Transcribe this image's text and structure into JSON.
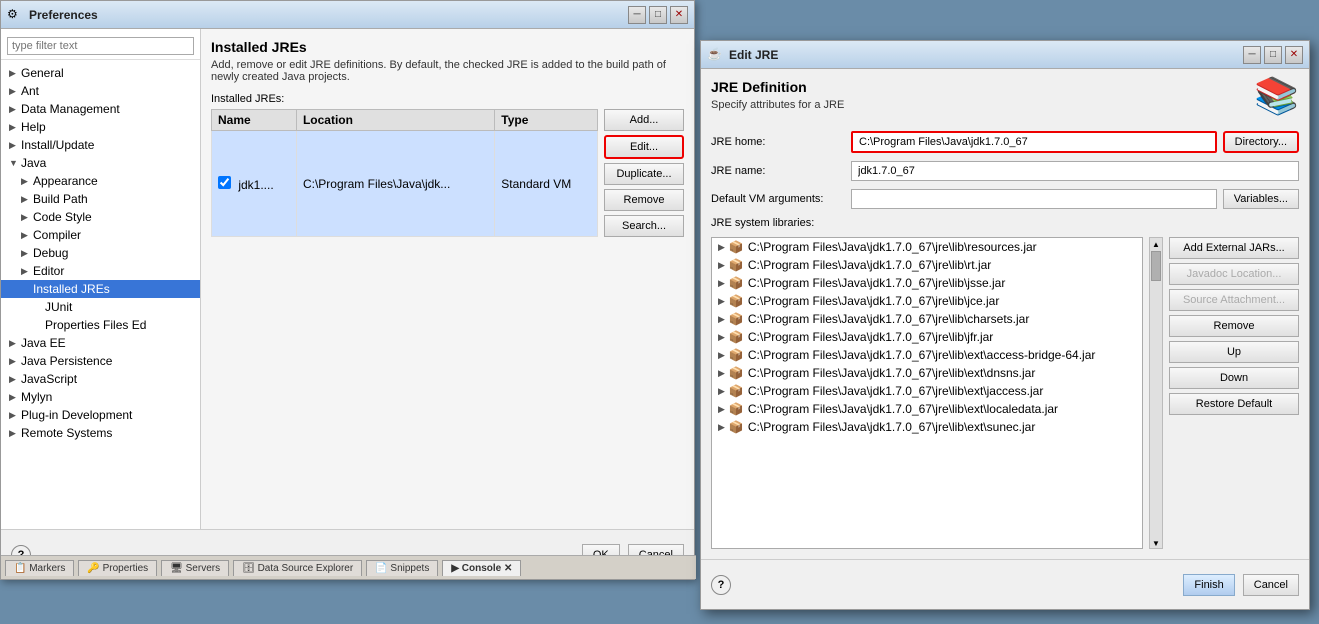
{
  "preferences": {
    "title": "Preferences",
    "filter_placeholder": "type filter text",
    "sidebar": {
      "items": [
        {
          "id": "general",
          "label": "General",
          "level": 1,
          "arrow": "▶",
          "selected": false
        },
        {
          "id": "ant",
          "label": "Ant",
          "level": 1,
          "arrow": "▶",
          "selected": false
        },
        {
          "id": "data-management",
          "label": "Data Management",
          "level": 1,
          "arrow": "▶",
          "selected": false
        },
        {
          "id": "help",
          "label": "Help",
          "level": 1,
          "arrow": "▶",
          "selected": false
        },
        {
          "id": "install-update",
          "label": "Install/Update",
          "level": 1,
          "arrow": "▶",
          "selected": false
        },
        {
          "id": "java",
          "label": "Java",
          "level": 1,
          "arrow": "▼",
          "selected": false
        },
        {
          "id": "appearance",
          "label": "Appearance",
          "level": 2,
          "arrow": "▶",
          "selected": false
        },
        {
          "id": "build-path",
          "label": "Build Path",
          "level": 2,
          "arrow": "▶",
          "selected": false
        },
        {
          "id": "code-style",
          "label": "Code Style",
          "level": 2,
          "arrow": "▶",
          "selected": false
        },
        {
          "id": "compiler",
          "label": "Compiler",
          "level": 2,
          "arrow": "▶",
          "selected": false
        },
        {
          "id": "debug",
          "label": "Debug",
          "level": 2,
          "arrow": "▶",
          "selected": false
        },
        {
          "id": "editor",
          "label": "Editor",
          "level": 2,
          "arrow": "▶",
          "selected": false
        },
        {
          "id": "installed-jres",
          "label": "Installed JREs",
          "level": 2,
          "arrow": "",
          "selected": true
        },
        {
          "id": "junit",
          "label": "JUnit",
          "level": 3,
          "arrow": "",
          "selected": false
        },
        {
          "id": "properties-files",
          "label": "Properties Files Ed",
          "level": 3,
          "arrow": "",
          "selected": false
        },
        {
          "id": "java-ee",
          "label": "Java EE",
          "level": 1,
          "arrow": "▶",
          "selected": false
        },
        {
          "id": "java-persistence",
          "label": "Java Persistence",
          "level": 1,
          "arrow": "▶",
          "selected": false
        },
        {
          "id": "javascript",
          "label": "JavaScript",
          "level": 1,
          "arrow": "▶",
          "selected": false
        },
        {
          "id": "mylyn",
          "label": "Mylyn",
          "level": 1,
          "arrow": "▶",
          "selected": false
        },
        {
          "id": "plug-in-development",
          "label": "Plug-in Development",
          "level": 1,
          "arrow": "▶",
          "selected": false
        },
        {
          "id": "remote-systems",
          "label": "Remote Systems",
          "level": 1,
          "arrow": "▶",
          "selected": false
        }
      ]
    },
    "main": {
      "title": "Installed JREs",
      "description": "Add, remove or edit JRE definitions. By default, the checked JRE is added to the build path of newly created Java projects.",
      "installed_label": "Installed JREs:",
      "table_headers": [
        "Name",
        "Location",
        "Type"
      ],
      "table_rows": [
        {
          "checked": true,
          "name": "jdk1....",
          "location": "C:\\Program Files\\Java\\jdk...",
          "type": "Standard VM"
        }
      ],
      "buttons": {
        "add": "Add...",
        "edit": "Edit...",
        "duplicate": "Duplicate...",
        "remove": "Remove",
        "search": "Search..."
      }
    },
    "bottom": {
      "ok": "OK",
      "cancel": "Cancel"
    }
  },
  "edit_jre": {
    "title": "Edit JRE",
    "section_title": "JRE Definition",
    "section_sub": "Specify attributes for a JRE",
    "jre_home_label": "JRE home:",
    "jre_home_value": "C:\\Program Files\\Java\\jdk1.7.0_67",
    "directory_btn": "Directory...",
    "jre_name_label": "JRE name:",
    "jre_name_value": "jdk1.7.0_67",
    "default_vm_label": "Default VM arguments:",
    "variables_btn": "Variables...",
    "system_libs_label": "JRE system libraries:",
    "libraries": [
      "C:\\Program Files\\Java\\jdk1.7.0_67\\jre\\lib\\resources.jar",
      "C:\\Program Files\\Java\\jdk1.7.0_67\\jre\\lib\\rt.jar",
      "C:\\Program Files\\Java\\jdk1.7.0_67\\jre\\lib\\jsse.jar",
      "C:\\Program Files\\Java\\jdk1.7.0_67\\jre\\lib\\jce.jar",
      "C:\\Program Files\\Java\\jdk1.7.0_67\\jre\\lib\\charsets.jar",
      "C:\\Program Files\\Java\\jdk1.7.0_67\\jre\\lib\\jfr.jar",
      "C:\\Program Files\\Java\\jdk1.7.0_67\\jre\\lib\\ext\\access-bridge-64.jar",
      "C:\\Program Files\\Java\\jdk1.7.0_67\\jre\\lib\\ext\\dnsns.jar",
      "C:\\Program Files\\Java\\jdk1.7.0_67\\jre\\lib\\ext\\jaccess.jar",
      "C:\\Program Files\\Java\\jdk1.7.0_67\\jre\\lib\\ext\\localedata.jar",
      "C:\\Program Files\\Java\\jdk1.7.0_67\\jre\\lib\\ext\\sunec.jar"
    ],
    "lib_buttons": {
      "add_external": "Add External JARs...",
      "javadoc": "Javadoc Location...",
      "source": "Source Attachment...",
      "remove": "Remove",
      "up": "Up",
      "down": "Down",
      "restore": "Restore Default"
    },
    "bottom": {
      "finish": "Finish",
      "cancel": "Cancel"
    }
  },
  "taskbar": {
    "tabs": [
      "Markers",
      "Properties",
      "Servers",
      "Data Source Explorer",
      "Snippets",
      "Console"
    ]
  }
}
